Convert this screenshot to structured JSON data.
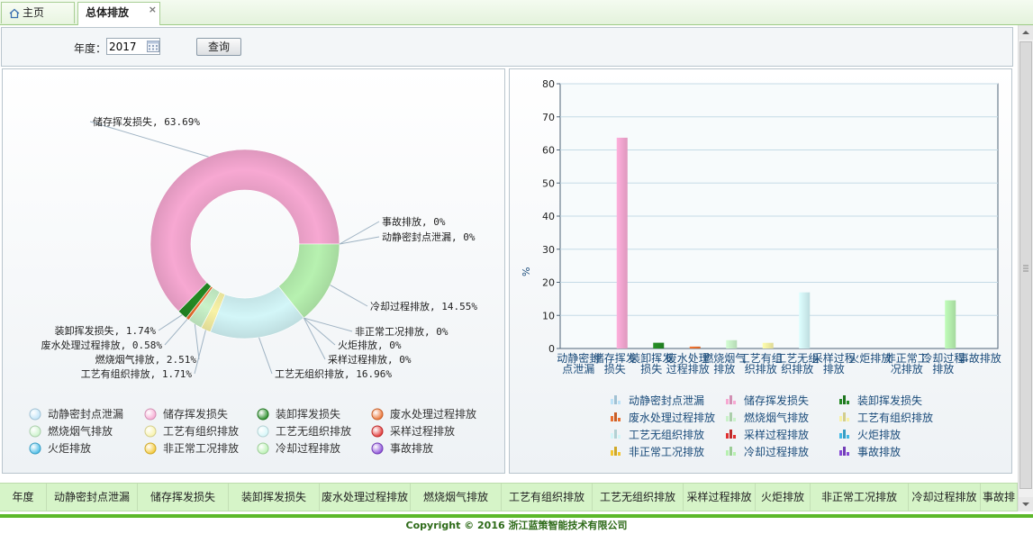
{
  "tabs": {
    "home_label": "主页",
    "active_label": "总体排放",
    "close_glyph": "×"
  },
  "query": {
    "year_label": "年度：",
    "year_value": "2017",
    "button_label": "查询"
  },
  "colors": {
    "accent": "#5cb82a",
    "header_bg": "#d6f4c8"
  },
  "chart_data": [
    {
      "type": "pie",
      "variant": "donut",
      "categories": [
        "动静密封点泄漏",
        "储存挥发损失",
        "装卸挥发损失",
        "废水处理过程排放",
        "燃烧烟气排放",
        "工艺有组织排放",
        "工艺无组织排放",
        "采样过程排放",
        "火炬排放",
        "非正常工况排放",
        "冷却过程排放",
        "事故排放"
      ],
      "values": [
        0,
        63.69,
        1.74,
        0.58,
        2.51,
        1.71,
        16.96,
        0,
        0,
        0,
        14.55,
        0
      ],
      "colors": [
        "#bde3f8",
        "#f7a8d2",
        "#248a24",
        "#ea6f2e",
        "#c9f2c9",
        "#f8f2a6",
        "#d3f6f8",
        "#e03030",
        "#42b9e6",
        "#f4c62f",
        "#b7f1b0",
        "#8648d6"
      ],
      "labels": {
        "cat0": "动静密封点泄漏, 0%",
        "cat1": "储存挥发损失, 63.69%",
        "cat2": "装卸挥发损失, 1.74%",
        "cat3": "废水处理过程排放, 0.58%",
        "cat4": "燃烧烟气排放, 2.51%",
        "cat5": "工艺有组织排放, 1.71%",
        "cat6": "工艺无组织排放, 16.96%",
        "cat7": "采样过程排放, 0%",
        "cat8": "火炬排放, 0%",
        "cat9": "非正常工况排放, 0%",
        "cat10": "冷却过程排放, 14.55%",
        "cat11": "事故排放, 0%"
      },
      "legend": "bottom"
    },
    {
      "type": "bar",
      "categories": [
        "动静密封点泄漏",
        "储存挥发损失",
        "装卸挥发损失",
        "废水处理过程排放",
        "燃烧烟气排放",
        "工艺有组织排放",
        "工艺无组织排放",
        "采样过程排放",
        "火炬排放",
        "非正常工况排放",
        "冷却过程排放",
        "事故排放"
      ],
      "values": [
        0,
        63.69,
        1.74,
        0.58,
        2.51,
        1.71,
        16.96,
        0,
        0,
        0,
        14.55,
        0
      ],
      "ylabel": "%",
      "ylim": [
        0,
        80
      ],
      "yticks": [
        "0",
        "10",
        "20",
        "30",
        "40",
        "50",
        "60",
        "70",
        "80"
      ],
      "grid": true,
      "legend": "bottom"
    }
  ],
  "table": {
    "columns": [
      "年度",
      "动静密封点泄漏",
      "储存挥发损失",
      "装卸挥发损失",
      "废水处理过程排放",
      "燃烧烟气排放",
      "工艺有组织排放",
      "工艺无组织排放",
      "采样过程排放",
      "火炬排放",
      "非正常工况排放",
      "冷却过程排放",
      "事故排"
    ]
  },
  "footer": {
    "copyright": "Copyright © 2016 浙江蓝策智能技术有限公司"
  }
}
